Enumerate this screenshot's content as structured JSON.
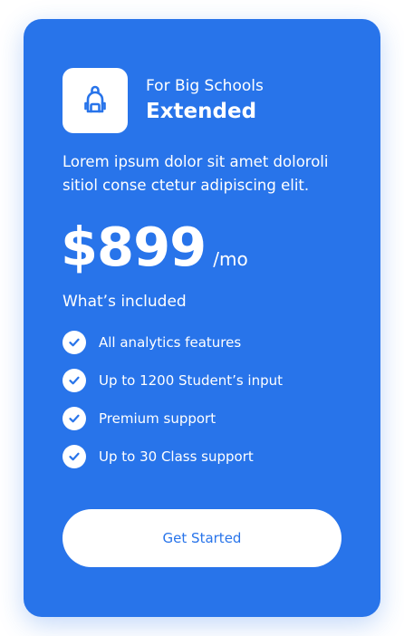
{
  "plan": {
    "subtitle": "For Big Schools",
    "name": "Extended",
    "icon": "backpack-icon",
    "description": "Lorem ipsum dolor sit amet doloroli sitiol conse ctetur adipiscing elit.",
    "price": "$899",
    "period": "/mo"
  },
  "included": {
    "heading": "What’s included",
    "items": [
      {
        "label": "All analytics features"
      },
      {
        "label": "Up to 1200 Student’s input"
      },
      {
        "label": "Premium support"
      },
      {
        "label": "Up to 30 Class support"
      }
    ]
  },
  "cta": {
    "label": "Get Started"
  },
  "colors": {
    "card_background": "#2874ea",
    "accent": "#2874ea",
    "text_on_card": "#ffffff",
    "button_background": "#ffffff"
  }
}
